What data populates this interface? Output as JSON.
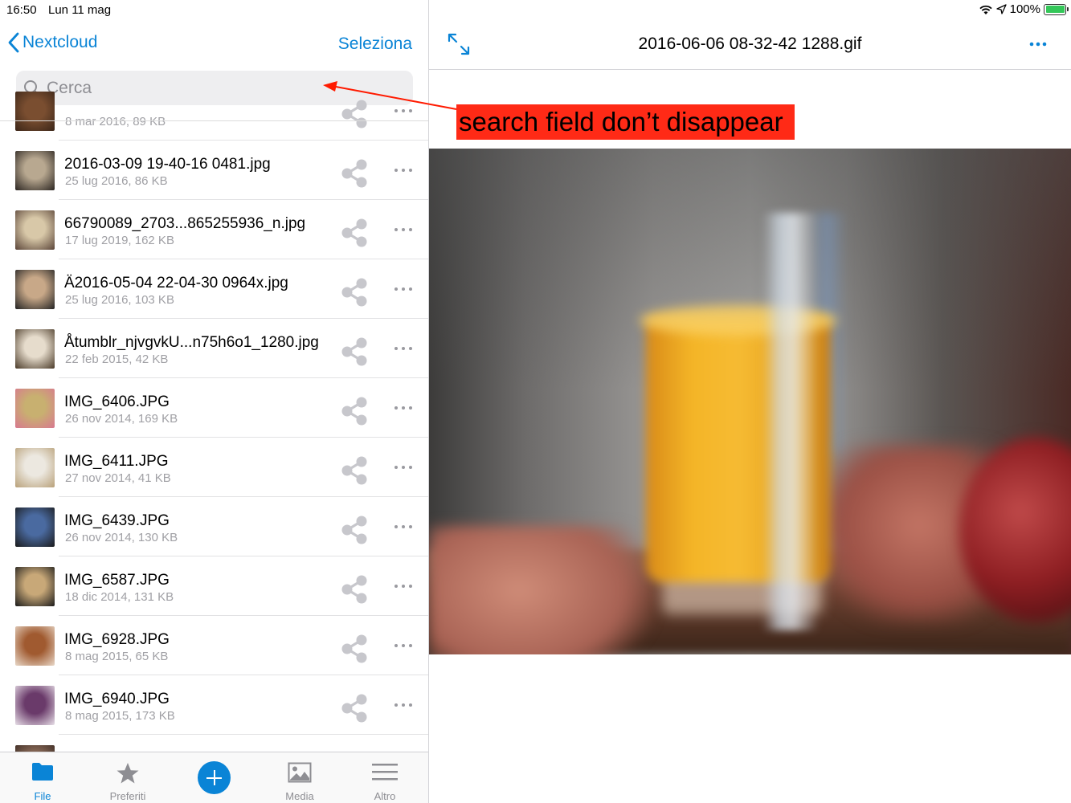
{
  "status_bar": {
    "time": "16:50",
    "date": "Lun 11 mag",
    "battery": "100%"
  },
  "nav": {
    "back_label": "Nextcloud",
    "select_label": "Seleziona"
  },
  "search": {
    "placeholder": "Cerca"
  },
  "files": [
    {
      "name": "",
      "meta": "8 mar 2016, 89 KB",
      "thumb": [
        "#7a4e30",
        "#3a2518"
      ]
    },
    {
      "name": "2016-03-09 19-40-16 0481.jpg",
      "meta": "25 lug 2016, 86 KB",
      "thumb": [
        "#b8a890",
        "#2a2420"
      ]
    },
    {
      "name": "66790089_2703...865255936_n.jpg",
      "meta": "17 lug 2019, 162 KB",
      "thumb": [
        "#d8c8a8",
        "#5a4438"
      ]
    },
    {
      "name": "Ä2016-05-04 22-04-30 0964x.jpg",
      "meta": "25 lug 2016, 103 KB",
      "thumb": [
        "#c8a888",
        "#222222"
      ]
    },
    {
      "name": "Åtumblr_njvgvkU...n75h6o1_1280.jpg",
      "meta": "22 feb 2015, 42 KB",
      "thumb": [
        "#e6dccc",
        "#4a3a28"
      ]
    },
    {
      "name": "IMG_6406.JPG",
      "meta": "26 nov 2014, 169 KB",
      "thumb": [
        "#c8b070",
        "#d87890"
      ]
    },
    {
      "name": "IMG_6411.JPG",
      "meta": "27 nov 2014, 41 KB",
      "thumb": [
        "#ece8e0",
        "#b8a078"
      ]
    },
    {
      "name": "IMG_6439.JPG",
      "meta": "26 nov 2014, 130 KB",
      "thumb": [
        "#4a6aa0",
        "#1a1a1a"
      ]
    },
    {
      "name": "IMG_6587.JPG",
      "meta": "18 dic 2014, 131 KB",
      "thumb": [
        "#c8a878",
        "#1a1a1a"
      ]
    },
    {
      "name": "IMG_6928.JPG",
      "meta": "8 mag 2015, 65 KB",
      "thumb": [
        "#a05a30",
        "#e8d8c8"
      ]
    },
    {
      "name": "IMG_6940.JPG",
      "meta": "8 mag 2015, 173 KB",
      "thumb": [
        "#6a3a6a",
        "#e8e0e8"
      ]
    },
    {
      "name": "",
      "meta": "",
      "thumb": [
        "#8a6a58",
        "#3a2a22"
      ]
    }
  ],
  "tabs": [
    {
      "label": "File"
    },
    {
      "label": "Preferiti"
    },
    {
      "label": "Media"
    },
    {
      "label": "Altro"
    }
  ],
  "viewer": {
    "title": "2016-06-06 08-32-42 1288.gif"
  },
  "annotation": {
    "text": "search field don’t disappear"
  },
  "colors": {
    "accent": "#0a84d6",
    "annotation_bg": "#ff2a16",
    "arrow": "#ff1a00"
  }
}
